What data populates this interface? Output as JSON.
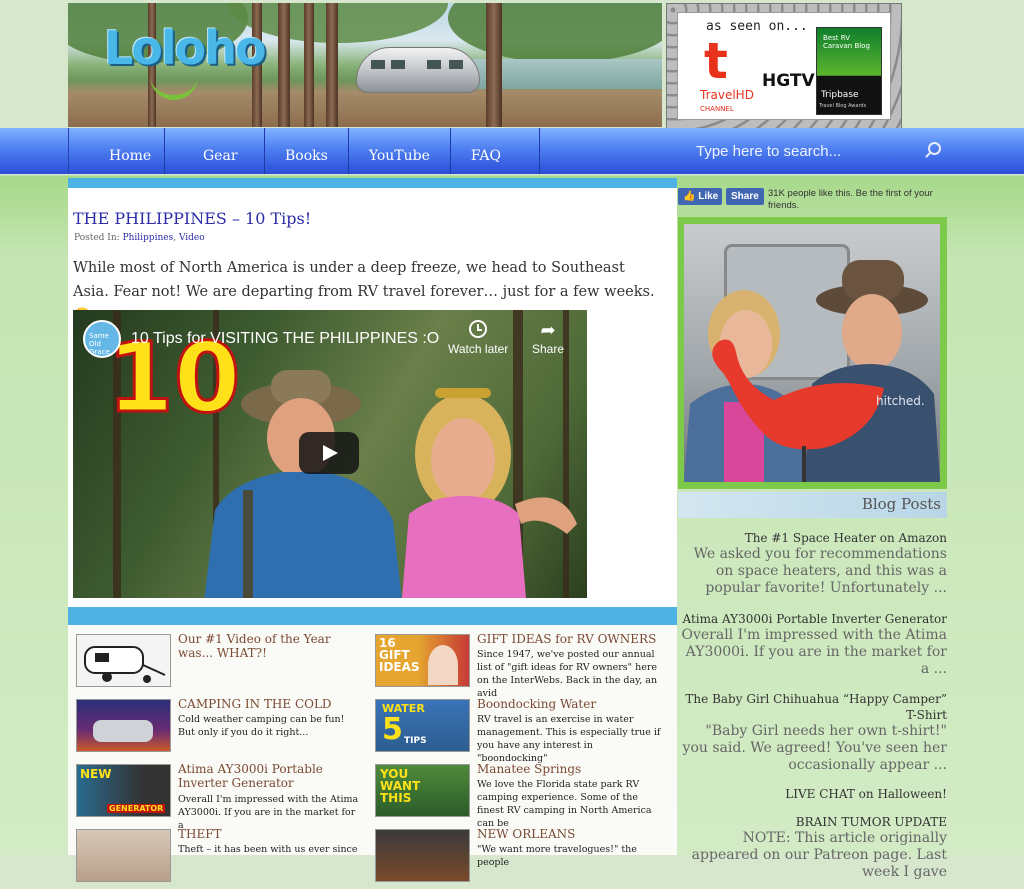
{
  "header": {
    "logo_text": "Loloho",
    "as_seen_on": "as seen on...",
    "travelhd_logo": "t",
    "travelhd_label": "TravelHD",
    "travelhd_channel": "CHANNEL",
    "hgtv": "HGTV",
    "award_line1": "Best RV Caravan Blog",
    "award_line2": "Tripbase",
    "award_line3": "Travel Blog Awards"
  },
  "nav": {
    "items": [
      {
        "label": "Home"
      },
      {
        "label": "Gear"
      },
      {
        "label": "Books"
      },
      {
        "label": "YouTube"
      },
      {
        "label": "FAQ"
      }
    ],
    "search_placeholder": "Type here to search..."
  },
  "post": {
    "title": "THE PHILIPPINES – 10 Tips!",
    "posted_in": "Posted In:",
    "category1": "Philippines",
    "category2": "Video",
    "body": "While most of North America is under a deep freeze, we head to Southeast Asia. Fear not! We are departing from RV travel forever… just for a few weeks. 🙂",
    "video": {
      "title": "10 Tips for VISITING THE PHILIPPINES :O",
      "big_number": "10",
      "watch_later": "Watch later",
      "share": "Share",
      "channel_badge": "Same Old Grace"
    }
  },
  "grid": [
    {
      "title": "Our #1 Video of the Year was... WHAT?!",
      "excerpt": ""
    },
    {
      "title": "GIFT IDEAS for RV OWNERS",
      "excerpt": "Since 1947, we've posted our annual list of \"gift ideas for RV owners\" here on the InterWebs. Back in the day, an avid",
      "thumb_text": "16 GIFT IDEAS"
    },
    {
      "title": "CAMPING IN THE COLD",
      "excerpt": "Cold weather camping can be fun! But only if you do it right..."
    },
    {
      "title": "Boondocking Water",
      "excerpt": "RV travel is an exercise in water management. This is especially true if you have any interest in \"boondocking\"",
      "thumb_text": "WATER",
      "thumb_text2": "5",
      "thumb_text3": "TIPS"
    },
    {
      "title": "Atima AY3000i Portable Inverter Generator",
      "excerpt": "Overall I'm impressed with the Atima AY3000i. If you are in the market for a",
      "thumb_text": "NEW",
      "thumb_text2": "GENERATOR"
    },
    {
      "title": "Manatee Springs",
      "excerpt": "We love the Florida state park RV camping experience. Some of the finest RV camping in North America can be",
      "thumb_text": "YOU WANT THIS"
    },
    {
      "title": "THEFT",
      "excerpt": "Theft – it has been with us ever since"
    },
    {
      "title": "NEW ORLEANS",
      "excerpt": "\"We want more travelogues!\" the people"
    }
  ],
  "sidebar": {
    "fb_like": "Like",
    "fb_share": "Share",
    "fb_text": "31K people like this. Be the first of your friends.",
    "photo_shirt": "hitched.",
    "blog_posts_heading": "Blog Posts",
    "posts": [
      {
        "title": "The #1 Space Heater on Amazon",
        "excerpt": "We asked you for recommendations on space heaters, and this was a popular favorite! Unfortunately ..."
      },
      {
        "title": "Atima AY3000i Portable Inverter Generator",
        "excerpt": "Overall I'm impressed with the Atima AY3000i. If you are in the market for a ..."
      },
      {
        "title": "The Baby Girl Chihuahua “Happy Camper” T-Shirt",
        "excerpt": "\"Baby Girl needs her own t-shirt!\" you said. We agreed! You've seen her occasionally appear ..."
      },
      {
        "title": "LIVE CHAT on Halloween!",
        "excerpt": ""
      },
      {
        "title": "BRAIN TUMOR UPDATE",
        "excerpt": "NOTE: This article originally appeared on our Patreon page. Last week I gave"
      }
    ]
  }
}
